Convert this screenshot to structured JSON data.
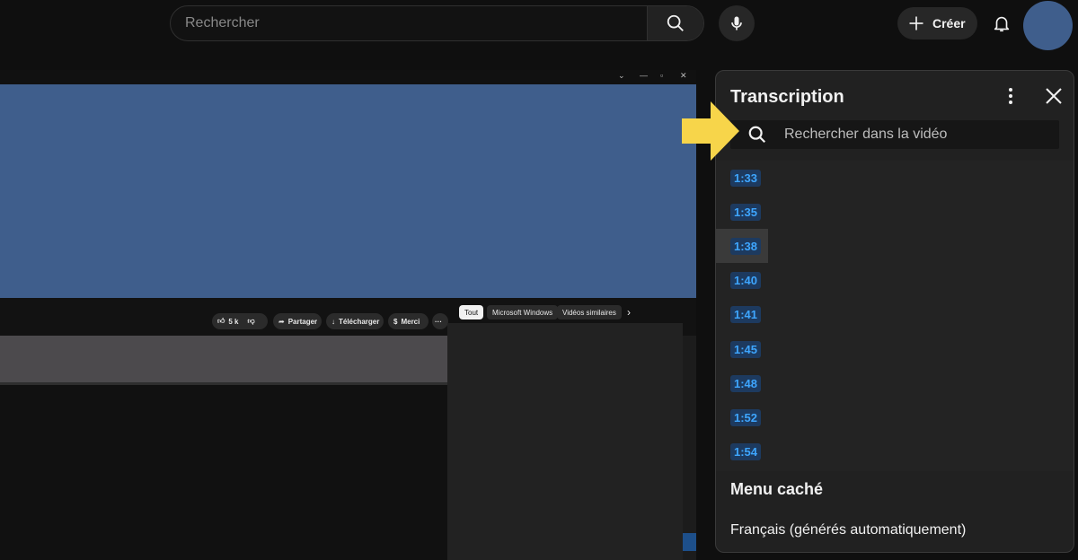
{
  "header": {
    "search_placeholder": "Rechercher",
    "create_label": "Créer"
  },
  "embedded": {
    "actions": {
      "likes": "5 k",
      "share": "Partager",
      "download": "Télécharger",
      "thanks": "Merci",
      "more": "···"
    },
    "chips": [
      "Tout",
      "Microsoft Windows",
      "Vidéos similaires"
    ],
    "chip_next": "›"
  },
  "transcript": {
    "title": "Transcription",
    "search_placeholder": "Rechercher dans la vidéo",
    "segments": [
      {
        "time": "1:33"
      },
      {
        "time": "1:35"
      },
      {
        "time": "1:38"
      },
      {
        "time": "1:40"
      },
      {
        "time": "1:41"
      },
      {
        "time": "1:45"
      },
      {
        "time": "1:48"
      },
      {
        "time": "1:52"
      },
      {
        "time": "1:54"
      }
    ],
    "menu_heading": "Menu caché",
    "language": "Français (générés automatiquement)"
  },
  "colors": {
    "accent_timestamp": "#3ea6ff",
    "avatar": "#3f5e8c",
    "arrow": "#f7d54a"
  },
  "icons": [
    "search-icon",
    "mic-icon",
    "plus-icon",
    "bell-icon",
    "more-vert-icon",
    "close-icon",
    "arrow-right-icon"
  ]
}
